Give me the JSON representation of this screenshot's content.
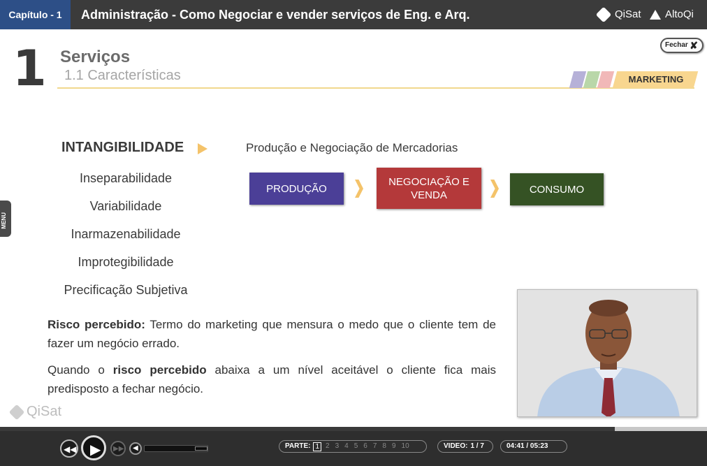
{
  "header": {
    "chapter": "Capítulo - 1",
    "course_title": "Administração - Como Negociar e vender serviços de Eng. e Arq.",
    "brand_qisat": "QiSat",
    "brand_altoqi": "AltoQi"
  },
  "slide": {
    "number": "1",
    "title": "Serviços",
    "subtitle": "1.1 Características",
    "close_label": "Fechar",
    "category_tag": "MARKETING",
    "side_menu_label": "MENU",
    "characteristics": {
      "active": "INTANGIBILIDADE",
      "items": [
        "Inseparabilidade",
        "Variabilidade",
        "Inarmazenabilidade",
        "Improtegibilidade",
        "Precificação Subjetiva"
      ]
    },
    "flow": {
      "title": "Produção e Negociação de Mercadorias",
      "steps": [
        "PRODUÇÃO",
        "NEGOCIAÇÃO E VENDA",
        "CONSUMO"
      ],
      "colors": [
        "#4b3f97",
        "#b4393a",
        "#355224"
      ]
    },
    "paragraph1": {
      "bold": "Risco percebido:",
      "text": " Termo do marketing que mensura o medo que o cliente tem de fazer um negócio errado."
    },
    "paragraph2": {
      "prefix": "Quando o ",
      "bold": "risco percebido",
      "suffix": " abaixa a um nível aceitável o cliente fica mais predisposto a fechar negócio."
    },
    "watermark": "QiSat"
  },
  "player": {
    "part_label": "PARTE:",
    "parts": [
      "1",
      "2",
      "3",
      "4",
      "5",
      "6",
      "7",
      "8",
      "9",
      "10"
    ],
    "current_part": "1",
    "video_label": "VIDEO:",
    "video_value": "1 / 7",
    "time": "04:41 / 05:23",
    "progress": 0.87
  },
  "icons": [
    "rewind-icon",
    "play-icon",
    "fast-forward-icon",
    "volume-icon",
    "close-icon",
    "qisat-logo-icon",
    "altoqi-logo-icon"
  ]
}
